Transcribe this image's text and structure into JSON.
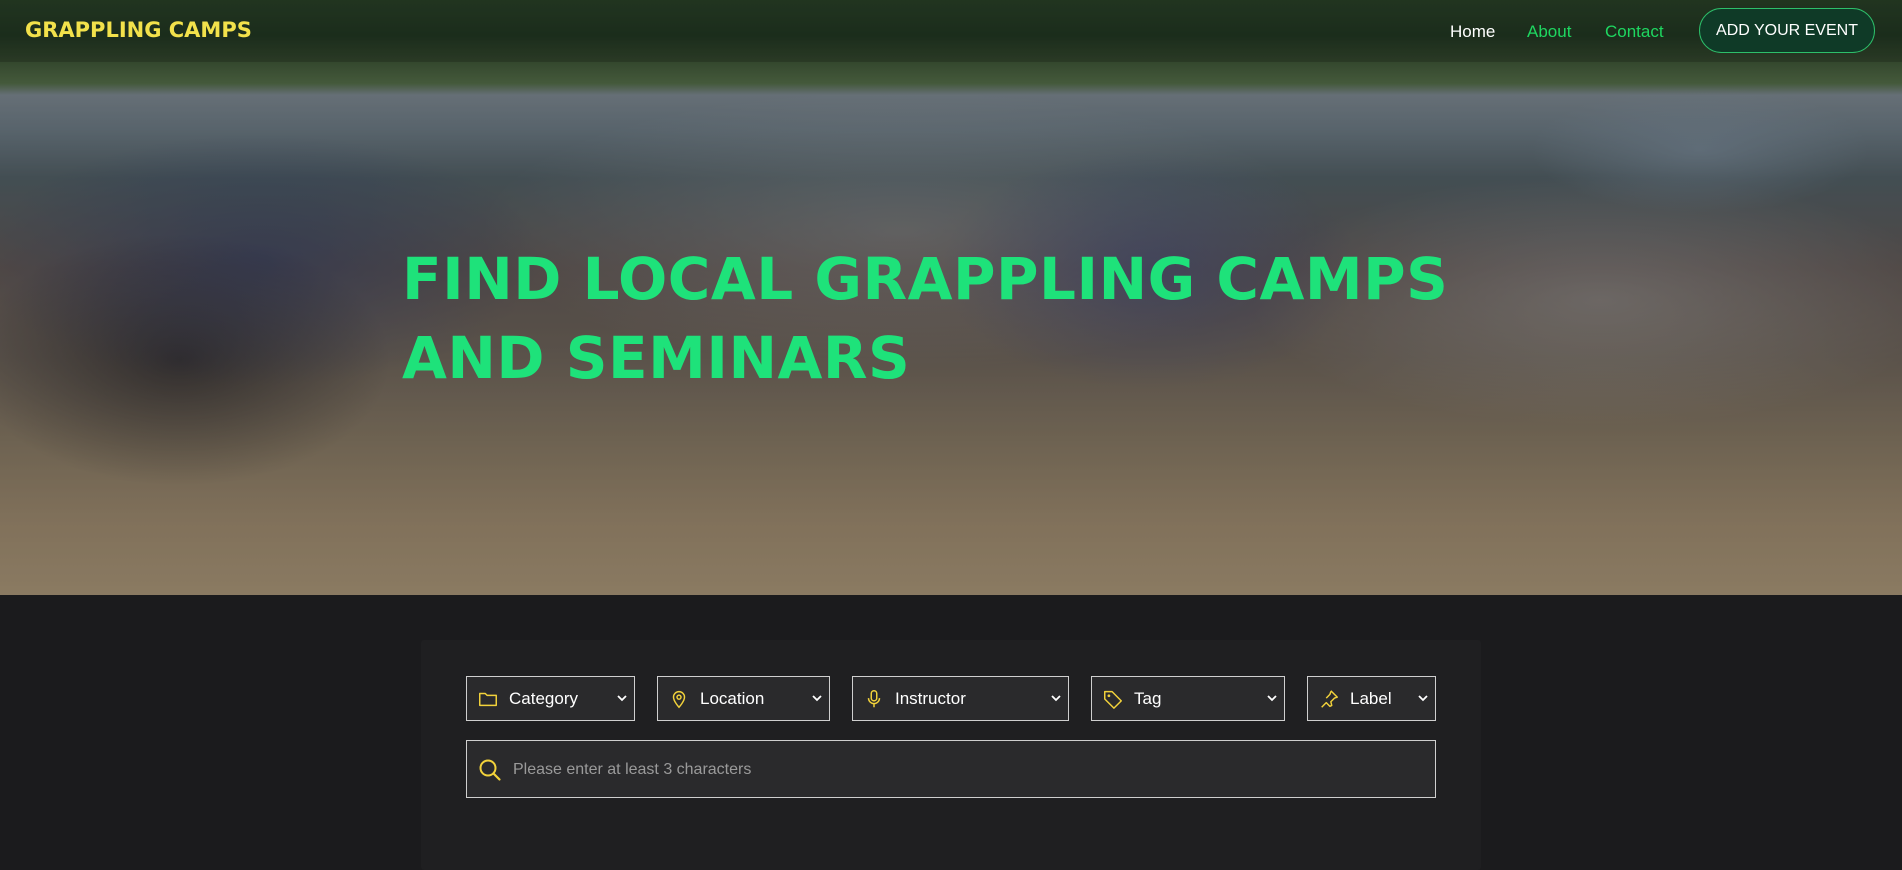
{
  "header": {
    "logo": "GRAPPLING CAMPS",
    "nav": {
      "home": "Home",
      "about": "About",
      "contact": "Contact"
    },
    "cta": "ADD YOUR EVENT"
  },
  "hero": {
    "title_line1": "FIND LOCAL GRAPPLING CAMPS",
    "title_line2": "AND SEMINARS"
  },
  "filters": {
    "category": {
      "label": "Category",
      "icon": "folder-icon"
    },
    "location": {
      "label": "Location",
      "icon": "map-pin-icon"
    },
    "instructor": {
      "label": "Instructor",
      "icon": "microphone-icon"
    },
    "tag": {
      "label": "Tag",
      "icon": "tag-icon"
    },
    "label": {
      "label": "Label",
      "icon": "pin-icon"
    }
  },
  "search": {
    "placeholder": "Please enter at least 3 characters",
    "icon": "search-icon"
  },
  "colors": {
    "accent_green": "#1ee27a",
    "logo_yellow": "#f2e14b",
    "icon_yellow": "#f2d23b",
    "background": "#1b1b1d"
  }
}
